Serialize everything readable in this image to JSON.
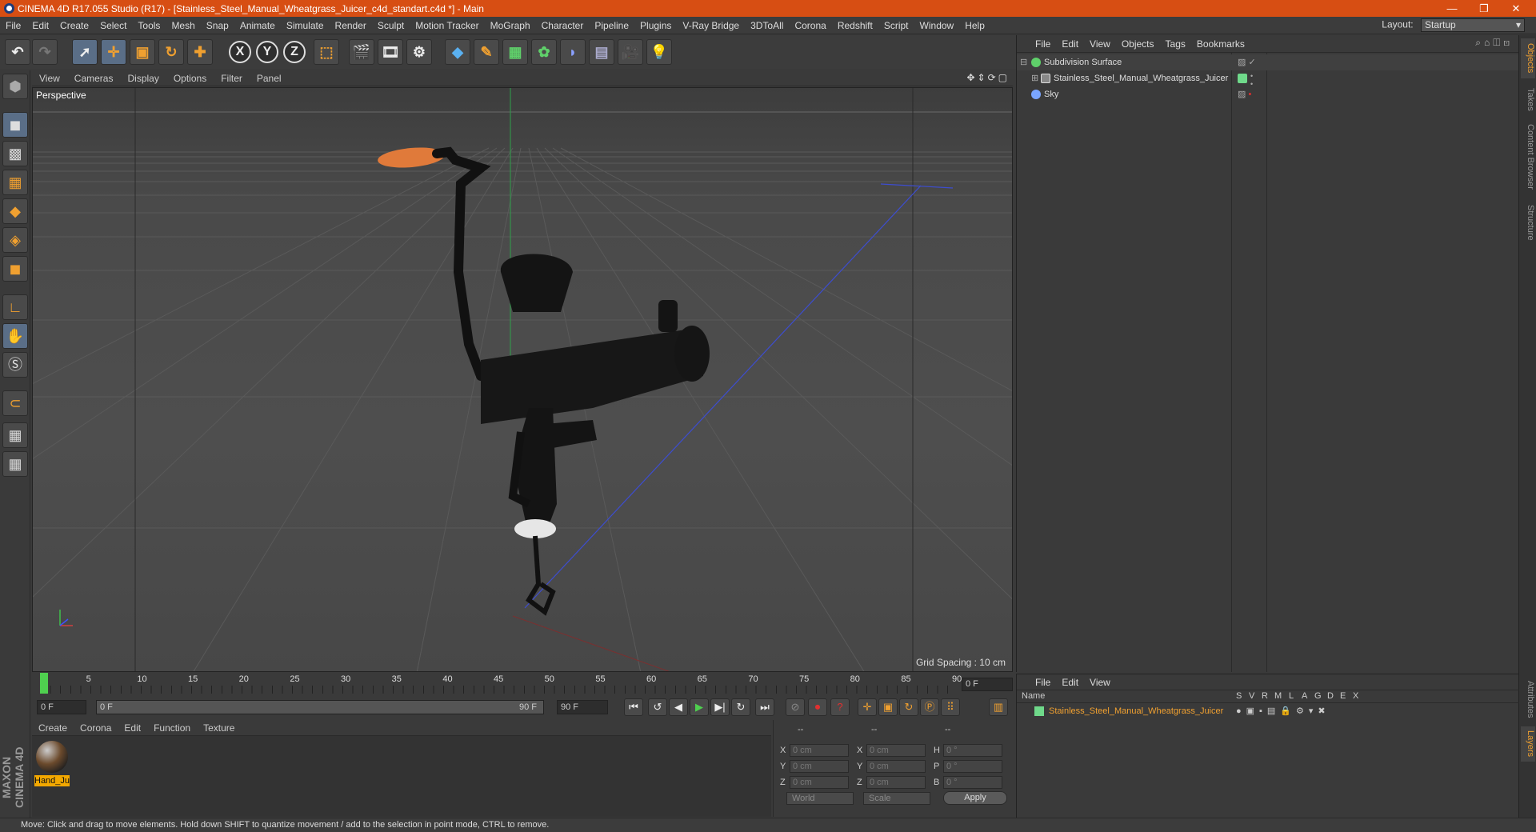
{
  "window": {
    "title": "CINEMA 4D R17.055 Studio (R17) - [Stainless_Steel_Manual_Wheatgrass_Juicer_c4d_standart.c4d *] - Main",
    "controls": [
      "—",
      "❐",
      "✕"
    ]
  },
  "menubar": {
    "items": [
      "File",
      "Edit",
      "Create",
      "Select",
      "Tools",
      "Mesh",
      "Snap",
      "Animate",
      "Simulate",
      "Render",
      "Sculpt",
      "Motion Tracker",
      "MoGraph",
      "Character",
      "Pipeline",
      "Plugins",
      "V-Ray Bridge",
      "3DToAll",
      "Corona",
      "Redshift",
      "Script",
      "Window",
      "Help"
    ],
    "layout_label": "Layout:",
    "layout_value": "Startup"
  },
  "toolbar": {
    "undo_icon": "undo-icon",
    "tools": [
      "select-icon",
      "move-icon",
      "scale-icon",
      "rotate-icon",
      "transform-icon"
    ],
    "axes": [
      "X",
      "Y",
      "Z"
    ]
  },
  "viewport": {
    "menu": [
      "View",
      "Cameras",
      "Display",
      "Options",
      "Filter",
      "Panel"
    ],
    "label": "Perspective",
    "grid_spacing": "Grid Spacing : 10 cm",
    "axis_labels": {
      "y": "y",
      "z": "z",
      "x": "x"
    }
  },
  "timeline": {
    "ticks": [
      "0",
      "5",
      "10",
      "15",
      "20",
      "25",
      "30",
      "35",
      "40",
      "45",
      "50",
      "55",
      "60",
      "65",
      "70",
      "75",
      "80",
      "85",
      "90"
    ],
    "current_frame": "0 F"
  },
  "transport": {
    "start_field": "0 F",
    "range_start": "0 F",
    "range_end": "90 F",
    "end_field": "90 F"
  },
  "material_manager": {
    "menu": [
      "Create",
      "Corona",
      "Edit",
      "Function",
      "Texture"
    ],
    "material_name": "Hand_Ju"
  },
  "coordinates": {
    "header": [
      "--",
      "--",
      "--"
    ],
    "rows": [
      {
        "a": "X",
        "av": "0 cm",
        "b": "X",
        "bv": "0 cm",
        "c": "H",
        "cv": "0 °"
      },
      {
        "a": "Y",
        "av": "0 cm",
        "b": "Y",
        "bv": "0 cm",
        "c": "P",
        "cv": "0 °"
      },
      {
        "a": "Z",
        "av": "0 cm",
        "b": "Z",
        "bv": "0 cm",
        "c": "B",
        "cv": "0 °"
      }
    ],
    "mode": "World",
    "mode2": "Scale",
    "apply": "Apply"
  },
  "objects_panel": {
    "menu": [
      "File",
      "Edit",
      "View",
      "Objects",
      "Tags",
      "Bookmarks"
    ],
    "objects": [
      {
        "name": "Subdivision Surface",
        "color": "#6fd98a"
      },
      {
        "name": "Stainless_Steel_Manual_Wheatgrass_Juicer",
        "color": "#6fd98a"
      },
      {
        "name": "Sky",
        "color": "#7aa6ff"
      }
    ]
  },
  "layers_panel": {
    "menu": [
      "File",
      "Edit",
      "View"
    ],
    "columns": [
      "Name",
      "S",
      "V",
      "R",
      "M",
      "L",
      "A",
      "G",
      "D",
      "E",
      "X"
    ],
    "layer_name": "Stainless_Steel_Manual_Wheatgrass_Juicer",
    "layer_color": "#6fd98a"
  },
  "side_tabs": [
    "Objects",
    "Takes",
    "Content Browser",
    "Structure"
  ],
  "side_tabs_lower": [
    "Attributes",
    "Layers"
  ],
  "statusbar": "Move: Click and drag to move elements. Hold down SHIFT to quantize movement / add to the selection in point mode, CTRL to remove.",
  "brand": "MAXON CINEMA 4D",
  "colors": {
    "titlebar": "#d74e13",
    "accent": "#f0a030",
    "selected": "#5a6e87"
  }
}
